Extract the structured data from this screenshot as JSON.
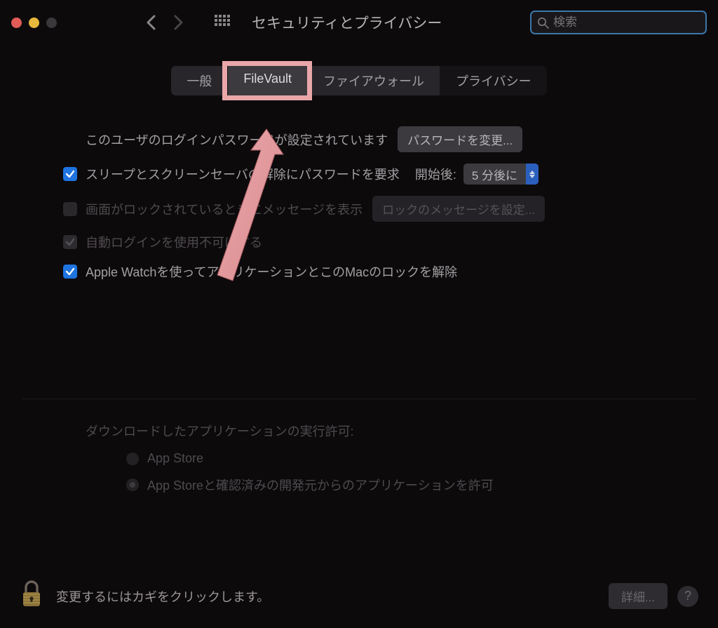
{
  "window_title": "セキュリティとプライバシー",
  "search": {
    "placeholder": "検索"
  },
  "tabs": [
    {
      "label": "一般"
    },
    {
      "label": "FileVault"
    },
    {
      "label": "ファイアウォール"
    },
    {
      "label": "プライバシー"
    }
  ],
  "login_password": {
    "text": "このユーザのログインパスワードが設定されています",
    "button": "パスワードを変更..."
  },
  "require_password": {
    "label": "スリープとスクリーンセーバの解除にパスワードを要求",
    "after_label": "開始後:",
    "delay_value": "5 分後に"
  },
  "lock_message": {
    "label": "画面がロックされているときにメッセージを表示",
    "button": "ロックのメッセージを設定..."
  },
  "auto_login_disable": {
    "label": "自動ログインを使用不可にする"
  },
  "apple_watch": {
    "label": "Apple Watchを使ってアプリケーションとこのMacのロックを解除"
  },
  "downloads": {
    "heading": "ダウンロードしたアプリケーションの実行許可:",
    "options": [
      "App Store",
      "App Storeと確認済みの開発元からのアプリケーションを許可"
    ]
  },
  "footer": {
    "lock_text": "変更するにはカギをクリックします。",
    "details": "詳細...",
    "help": "?"
  }
}
